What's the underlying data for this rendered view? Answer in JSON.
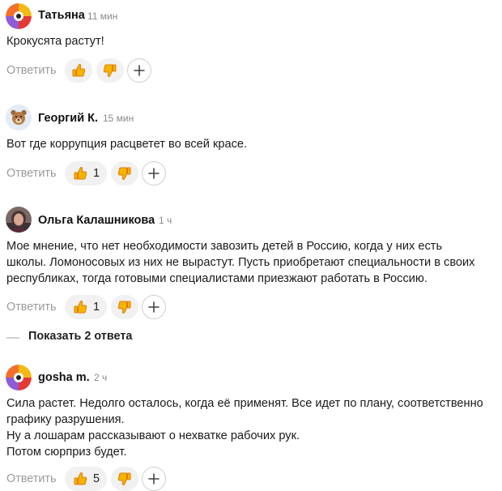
{
  "colors": {
    "thumb_fill": "#f4b400",
    "thumb_outline": "#e07b00",
    "reply_text": "#9a9a9a",
    "pill_bg": "#f1f1f1"
  },
  "comments": [
    {
      "author": "Татьяна",
      "time": "11 мин",
      "avatar_icon": "multicolor-circle-avatar",
      "text_lines": [
        "Крокусята растут!"
      ],
      "reply_label": "Ответить",
      "likes": "",
      "like_icon": "thumbs-up-icon",
      "dislike_icon": "thumbs-down-icon",
      "add_icon": "plus-icon"
    },
    {
      "author": "Георгий К.",
      "time": "15 мин",
      "avatar_icon": "bear-face-avatar",
      "text_lines": [
        "Вот где коррупция расцветет во всей красе."
      ],
      "reply_label": "Ответить",
      "likes": "1",
      "like_icon": "thumbs-up-icon",
      "dislike_icon": "thumbs-down-icon",
      "add_icon": "plus-icon"
    },
    {
      "author": "Ольга Калашникова",
      "time": "1 ч",
      "avatar_icon": "photo-avatar",
      "text_lines": [
        "Мое мнение, что нет необходимости завозить детей в Россию, когда у них есть",
        "школы. Ломоносовых из них не вырастут. Пусть приобретают специальности в своих",
        "республиках, тогда готовыми специалистами приезжают работать в Россию."
      ],
      "reply_label": "Ответить",
      "likes": "1",
      "like_icon": "thumbs-up-icon",
      "dislike_icon": "thumbs-down-icon",
      "add_icon": "plus-icon"
    },
    {
      "author": "gosha m.",
      "time": "2 ч",
      "avatar_icon": "multicolor-circle-avatar",
      "text_lines": [
        "Сила растет. Недолго осталось, когда её применят. Все идет по плану, соответственно",
        "графику разрушения.",
        "Ну а лошарам рассказывают о нехватке рабочих рук.",
        "Потом сюрприз будет."
      ],
      "reply_label": "Ответить",
      "likes": "5",
      "like_icon": "thumbs-up-icon",
      "dislike_icon": "thumbs-down-icon",
      "add_icon": "plus-icon"
    }
  ],
  "show_replies_label": "Показать 2 ответа"
}
